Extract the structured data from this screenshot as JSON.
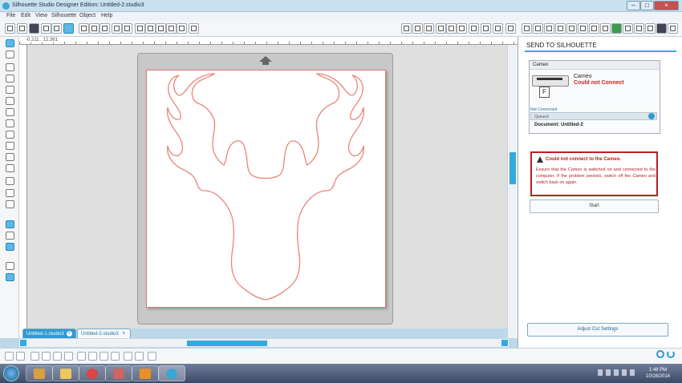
{
  "window": {
    "title": "Silhouette Studio Designer Edition: Untitled-2.studio3"
  },
  "menu": [
    "File",
    "Edit",
    "View",
    "Silhouette",
    "Object",
    "Help"
  ],
  "ruler": {
    "coords": "-0.211 , 12.361"
  },
  "document_tabs": [
    {
      "label": "Untitled-1.studio3",
      "active": true
    },
    {
      "label": "Untitled-2.studio3",
      "active": false
    }
  ],
  "panel": {
    "title": "SEND TO SILHOUETTE",
    "device_header": "Cameo",
    "device_name": "Cameo",
    "device_status": "Could not Connect",
    "doc_icon_letter": "F",
    "connection_state": "Not Connected",
    "queue_label": "Queued",
    "document_line": "Document: Untitled-2",
    "error": {
      "title": "Could not connect to the Cameo.",
      "body": "Ensure that the Cameo is switched on and connected to the computer. If the problem persists, switch off the Cameo and switch back on again."
    },
    "start_button": "Start",
    "adjust_button": "Adjust Cut Settings"
  },
  "taskbar": {
    "time": "1:48 PM",
    "date": "10/28/2014"
  },
  "colors": {
    "accent": "#33a9de",
    "cut_line": "#e8857b",
    "error": "#b82020"
  }
}
